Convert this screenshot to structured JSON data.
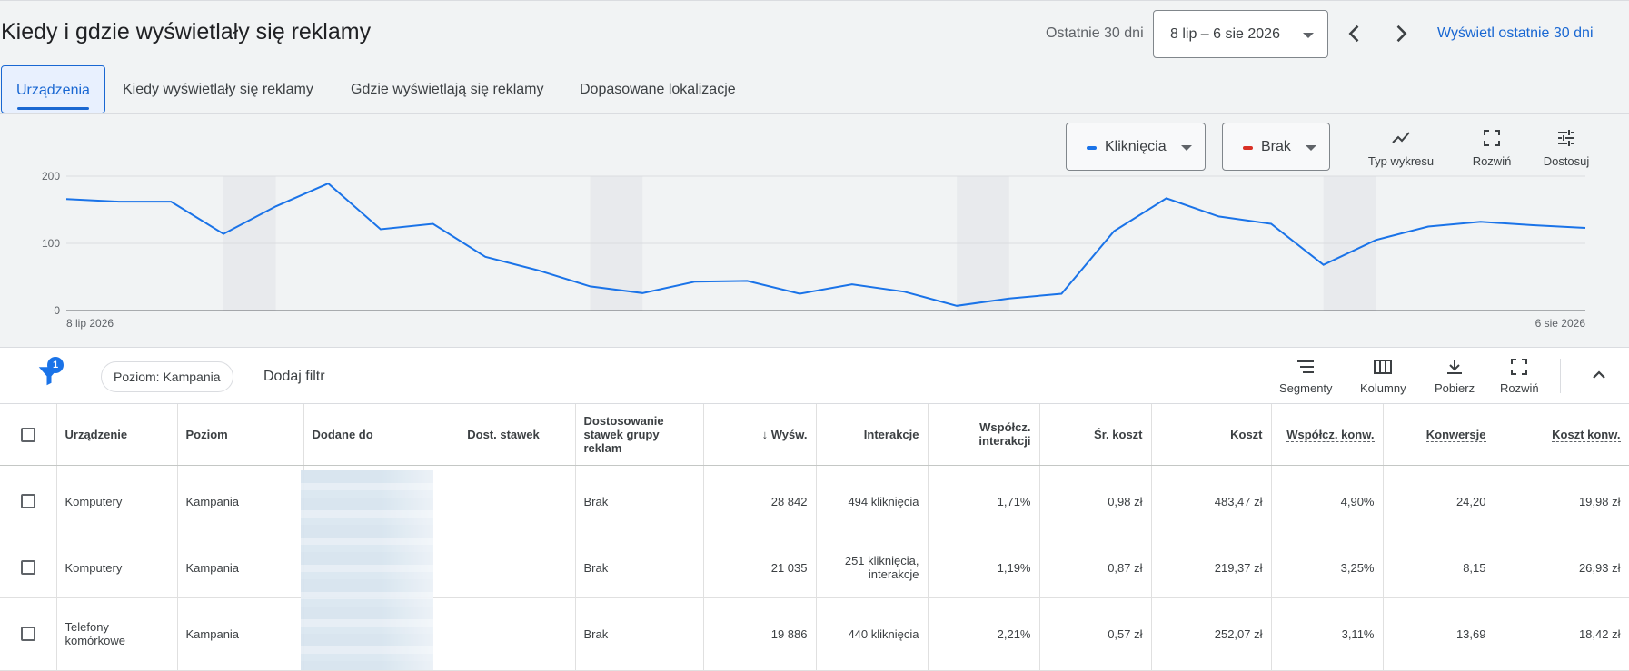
{
  "header": {
    "title": "Kiedy i gdzie wyświetlały się reklamy",
    "range_label": "Ostatnie 30 dni",
    "date_range": "8 lip – 6 sie 2026",
    "show_last": "Wyświetl ostatnie 30 dni"
  },
  "tabs": [
    {
      "label": "Urządzenia",
      "active": true
    },
    {
      "label": "Kiedy wyświetlały się reklamy",
      "active": false
    },
    {
      "label": "Gdzie wyświetlają się reklamy",
      "active": false
    },
    {
      "label": "Dopasowane lokalizacje",
      "active": false
    }
  ],
  "chart_controls": {
    "metric1": "Kliknięcia",
    "metric2": "Brak",
    "tools": [
      "Typ wykresu",
      "Rozwiń",
      "Dostosuj"
    ]
  },
  "colors": {
    "accent": "#1967d2",
    "series": "#1a73e8",
    "metric2": "#d93025"
  },
  "chart_data": {
    "type": "line",
    "series": [
      {
        "name": "Kliknięcia",
        "values": [
          166,
          162,
          162,
          114,
          155,
          189,
          121,
          129,
          80,
          60,
          36,
          26,
          43,
          44,
          25,
          39,
          28,
          7,
          18,
          25,
          118,
          167,
          140,
          129,
          68,
          105,
          125,
          132,
          127,
          123
        ]
      }
    ],
    "x_labels": [
      "8 lip 2026",
      "6 sie 2026"
    ],
    "y_ticks": [
      0,
      100,
      200
    ],
    "ylim": [
      0,
      200
    ],
    "shaded_days": [
      3,
      10,
      17,
      24
    ],
    "grid": true
  },
  "filterbar": {
    "badge": "1",
    "chip": "Poziom: Kampania",
    "add_filter": "Dodaj filtr",
    "tools": [
      "Segmenty",
      "Kolumny",
      "Pobierz",
      "Rozwiń"
    ]
  },
  "table": {
    "headers": [
      "Urządzenie",
      "Poziom",
      "Dodane do",
      "Dost. stawek",
      "Dostosowanie stawek grupy reklam",
      "Wyśw.",
      "Interakcje",
      "Współcz. interakcji",
      "Śr. koszt",
      "Koszt",
      "Współcz. konw.",
      "Konwersje",
      "Koszt konw."
    ],
    "rows": [
      [
        "Komputery",
        "Kampania",
        "",
        "",
        "Brak",
        "28 842",
        "494 kliknięcia",
        "1,71%",
        "0,98 zł",
        "483,47 zł",
        "4,90%",
        "24,20",
        "19,98 zł"
      ],
      [
        "Komputery",
        "Kampania",
        "",
        "",
        "Brak",
        "21 035",
        "251 kliknięcia, interakcje",
        "1,19%",
        "0,87 zł",
        "219,37 zł",
        "3,25%",
        "8,15",
        "26,93 zł"
      ],
      [
        "Telefony komórkowe",
        "Kampania",
        "",
        "",
        "Brak",
        "19 886",
        "440 kliknięcia",
        "2,21%",
        "0,57 zł",
        "252,07 zł",
        "3,11%",
        "13,69",
        "18,42 zł"
      ]
    ]
  }
}
